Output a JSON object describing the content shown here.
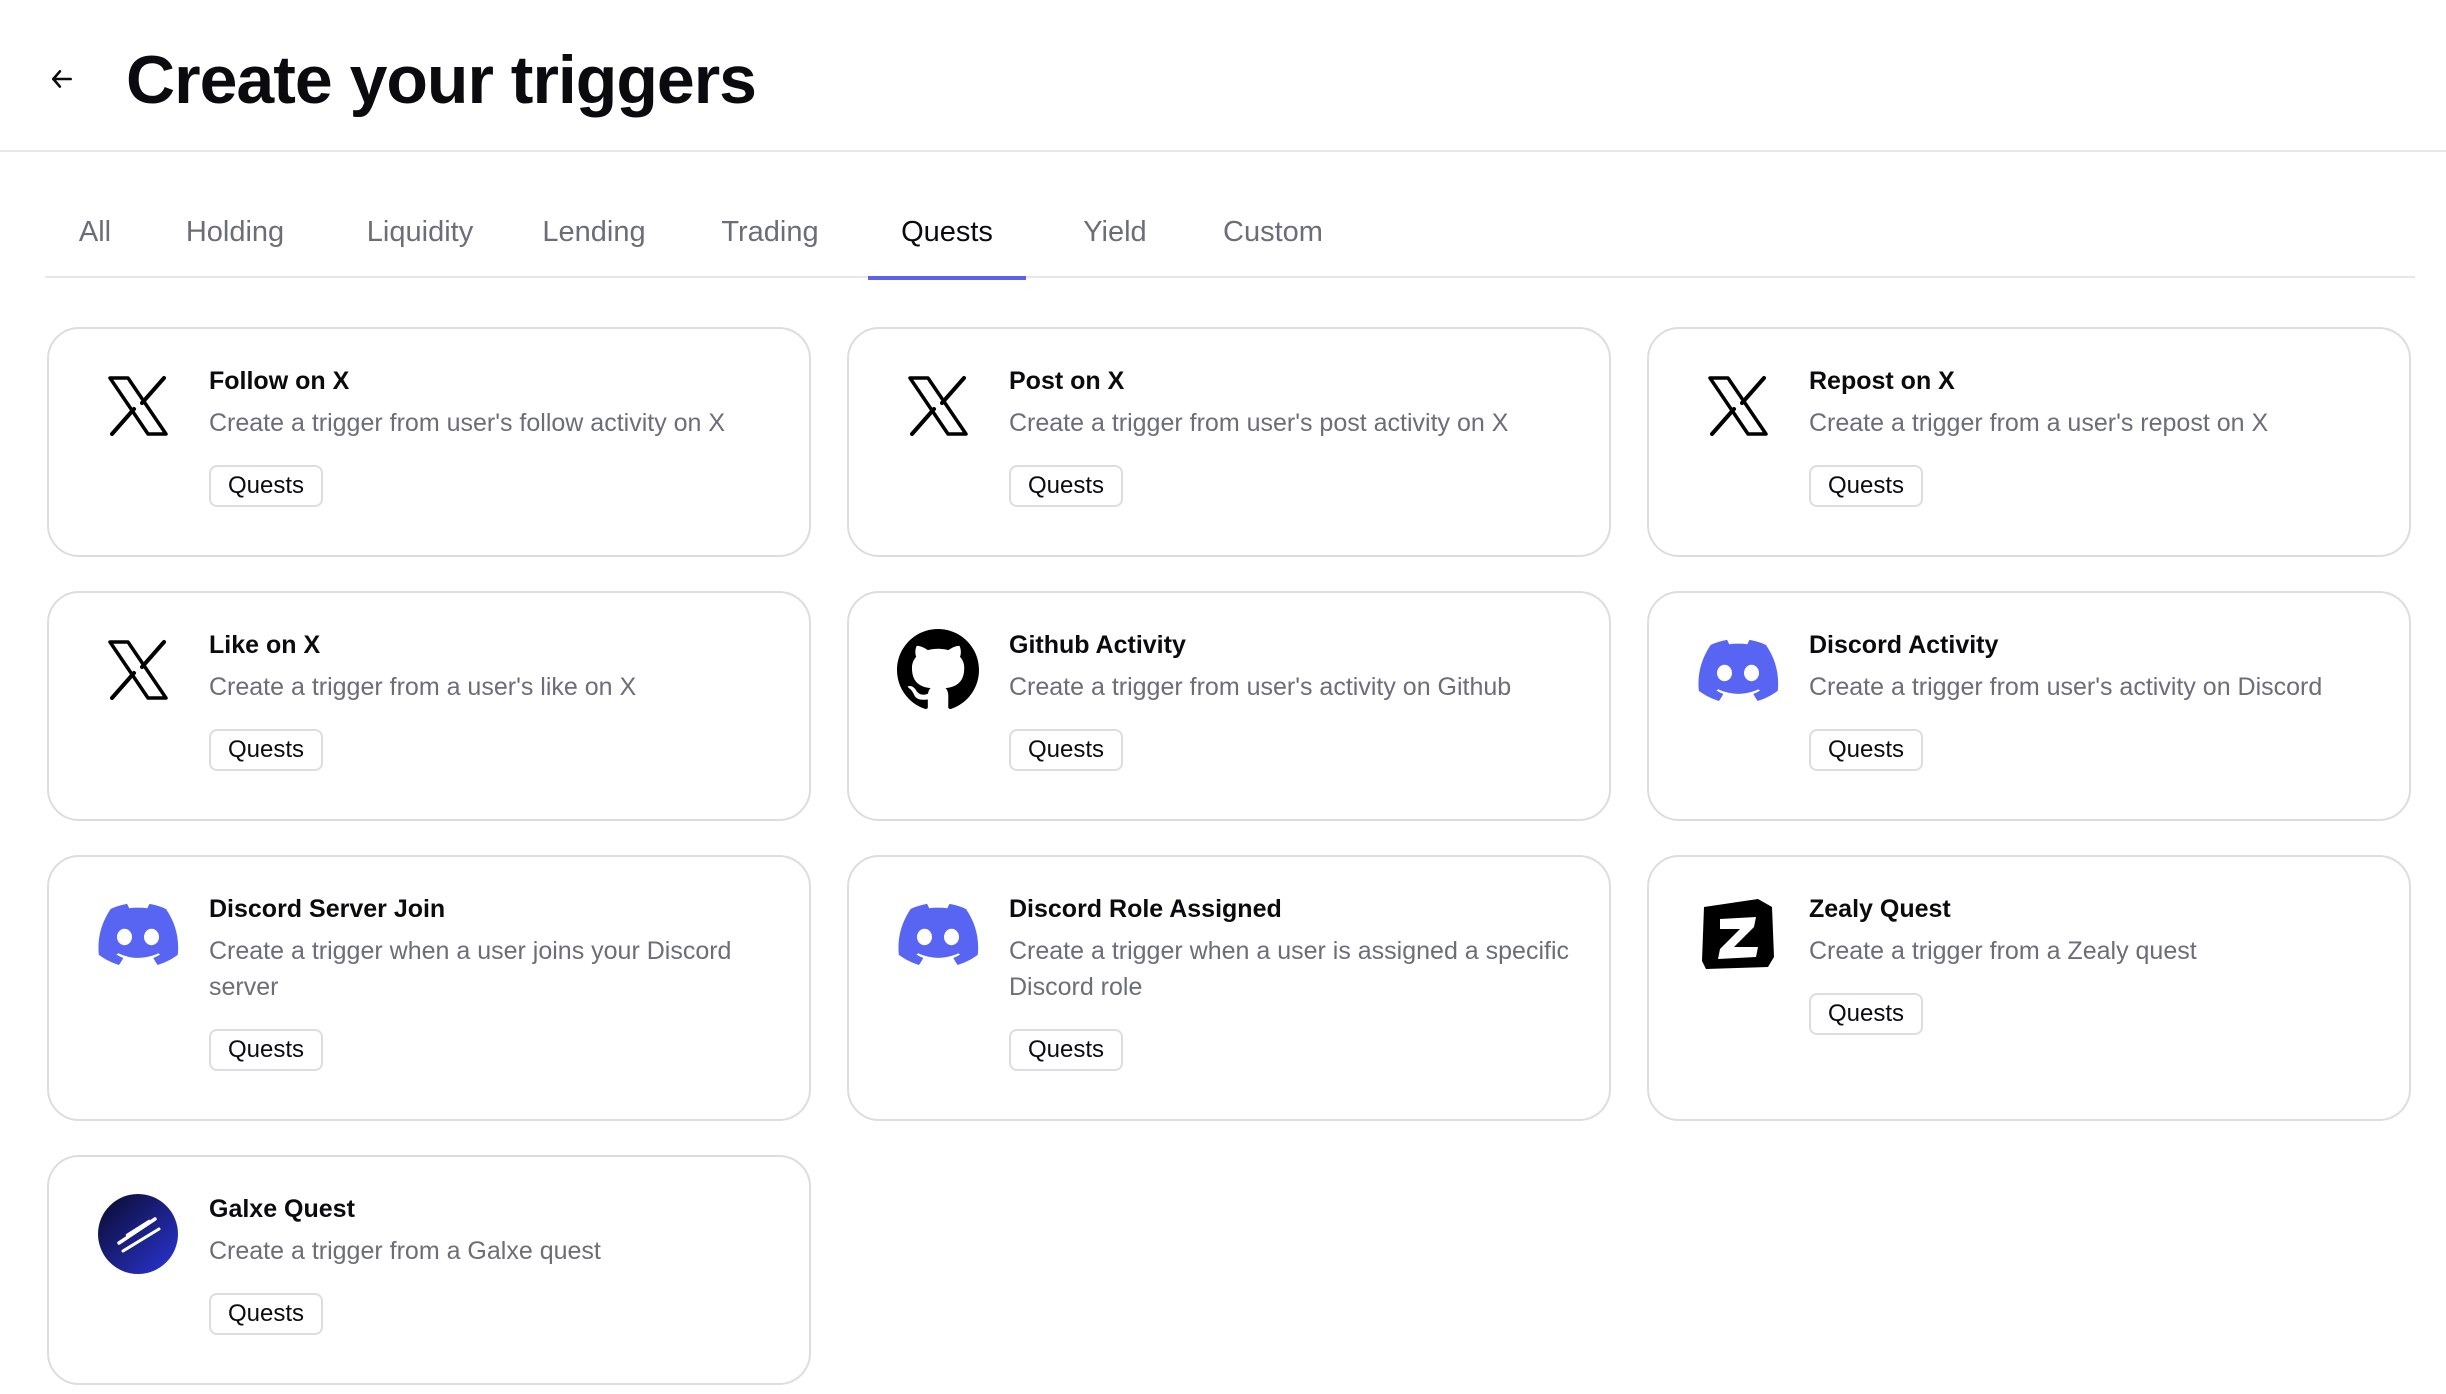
{
  "header": {
    "title": "Create your triggers",
    "back_icon": "arrow-left-icon"
  },
  "tabs": [
    {
      "label": "All"
    },
    {
      "label": "Holding"
    },
    {
      "label": "Liquidity"
    },
    {
      "label": "Lending"
    },
    {
      "label": "Trading"
    },
    {
      "label": "Quests",
      "active": true
    },
    {
      "label": "Yield"
    },
    {
      "label": "Custom"
    }
  ],
  "accent_color": "#5b61e8",
  "cards": [
    {
      "icon": "x-logo-icon",
      "title": "Follow on X",
      "description": "Create a trigger from user's follow activity on X",
      "badge": "Quests"
    },
    {
      "icon": "x-logo-icon",
      "title": "Post on X",
      "description": "Create a trigger from user's post activity on X",
      "badge": "Quests"
    },
    {
      "icon": "x-logo-icon",
      "title": "Repost on X",
      "description": "Create a trigger from a user's repost on X",
      "badge": "Quests"
    },
    {
      "icon": "x-logo-icon",
      "title": "Like on X",
      "description": "Create a trigger from a user's like on X",
      "badge": "Quests"
    },
    {
      "icon": "github-logo-icon",
      "title": "Github Activity",
      "description": "Create a trigger from user's activity on Github",
      "badge": "Quests"
    },
    {
      "icon": "discord-logo-icon",
      "title": "Discord Activity",
      "description": "Create a trigger from user's activity on Discord",
      "badge": "Quests"
    },
    {
      "icon": "discord-logo-icon",
      "title": "Discord Server Join",
      "description": "Create a trigger when a user joins your Discord server",
      "badge": "Quests"
    },
    {
      "icon": "discord-logo-icon",
      "title": "Discord Role Assigned",
      "description": "Create a trigger when a user is assigned a specific Discord role",
      "badge": "Quests"
    },
    {
      "icon": "zealy-logo-icon",
      "title": "Zealy Quest",
      "description": "Create a trigger from a Zealy quest",
      "badge": "Quests"
    },
    {
      "icon": "galxe-logo-icon",
      "title": "Galxe Quest",
      "description": "Create a trigger from a Galxe quest",
      "badge": "Quests"
    }
  ]
}
